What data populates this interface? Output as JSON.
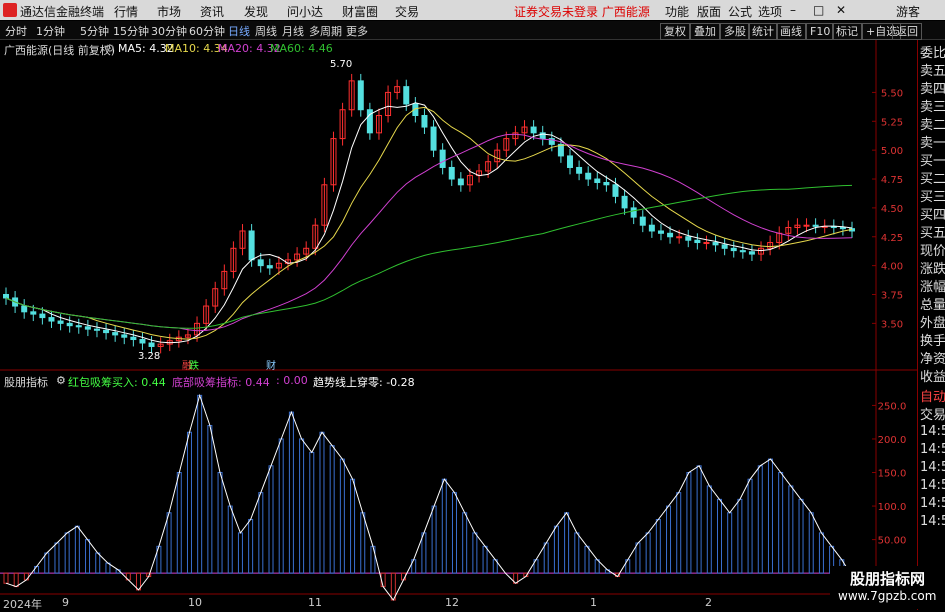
{
  "app": {
    "title": "通达信金融终端"
  },
  "menu": [
    "行情",
    "市场",
    "资讯",
    "发现",
    "问小达",
    "财富圈",
    "交易"
  ],
  "notice": "证券交易未登录  广西能源",
  "right_menu": [
    "功能",
    "版面",
    "公式",
    "选项"
  ],
  "user": "游客",
  "periods": [
    "分时",
    "1分钟",
    "5分钟",
    "15分钟",
    "30分钟",
    "60分钟",
    "日线",
    "周线",
    "月线",
    "多周期",
    "更多"
  ],
  "active_period": "日线",
  "toolbar": [
    "复权",
    "叠加",
    "多股",
    "统计",
    "画线",
    "F10",
    "标记",
    "+自选",
    "返回"
  ],
  "stock_header": {
    "name": "广西能源(日线 前复权)",
    "ma5": "MA5: 4.32",
    "ma10": "MA10: 4.34",
    "ma20": "MA20: 4.32",
    "ma60": "MA60: 4.46"
  },
  "annotations": {
    "high": "5.70",
    "low": "3.28",
    "badge1": "融",
    "badge1b": "跌",
    "badge2": "财"
  },
  "indicator_header": {
    "name": "股朋指标",
    "red_pack": "红包吸筹买入: 0.44",
    "bottom": "底部吸筹指标: 0.44",
    "zero": ": 0.00",
    "trend": "趋势线上穿零: -0.28"
  },
  "sidebar": [
    "委比",
    "卖五",
    "卖四",
    "卖三",
    "卖二",
    "卖一",
    "买一",
    "买二",
    "买三",
    "买四",
    "买五",
    "现价",
    "涨跌",
    "涨幅",
    "总量",
    "外盘",
    "换手",
    "净资",
    "收益",
    "自动",
    "交易",
    "14:56",
    "14:56",
    "14:56",
    "14:56",
    "14:56",
    "14:56"
  ],
  "dates": [
    {
      "label": "2024年"
    },
    {
      "label": "9"
    },
    {
      "label": "10"
    },
    {
      "label": "11"
    },
    {
      "label": "12"
    },
    {
      "label": "1"
    },
    {
      "label": "2"
    }
  ],
  "watermark": {
    "title": "股朋指标网",
    "url": "www.7gpzb.com"
  },
  "chart_data": [
    {
      "type": "candlestick",
      "title": "广西能源(日线 前复权)",
      "ylim": [
        3.2,
        5.85
      ],
      "yticks": [
        "5.50",
        "5.25",
        "5.00",
        "4.75",
        "4.50",
        "4.25",
        "4.00",
        "3.75",
        "3.50"
      ],
      "series": [
        {
          "name": "MA5",
          "color": "#ffffff"
        },
        {
          "name": "MA10",
          "color": "#e6d84c"
        },
        {
          "name": "MA20",
          "color": "#d040d0"
        },
        {
          "name": "MA60",
          "color": "#30c030"
        }
      ],
      "close": [
        3.72,
        3.65,
        3.6,
        3.58,
        3.55,
        3.52,
        3.5,
        3.48,
        3.47,
        3.45,
        3.44,
        3.42,
        3.4,
        3.38,
        3.36,
        3.33,
        3.3,
        3.32,
        3.35,
        3.38,
        3.4,
        3.5,
        3.65,
        3.8,
        3.95,
        4.15,
        4.3,
        4.05,
        4.0,
        3.98,
        4.02,
        4.05,
        4.1,
        4.15,
        4.35,
        4.7,
        5.1,
        5.35,
        5.6,
        5.35,
        5.15,
        5.3,
        5.5,
        5.55,
        5.4,
        5.3,
        5.2,
        5.0,
        4.85,
        4.75,
        4.7,
        4.78,
        4.82,
        4.9,
        5.0,
        5.1,
        5.15,
        5.2,
        5.15,
        5.1,
        5.05,
        4.95,
        4.85,
        4.8,
        4.75,
        4.72,
        4.7,
        4.6,
        4.5,
        4.42,
        4.35,
        4.3,
        4.28,
        4.25,
        4.25,
        4.22,
        4.2,
        4.2,
        4.18,
        4.15,
        4.13,
        4.12,
        4.1,
        4.15,
        4.2,
        4.28,
        4.33,
        4.35,
        4.35,
        4.34,
        4.34,
        4.33,
        4.32,
        4.3
      ]
    },
    {
      "type": "bar",
      "title": "股朋指标",
      "ylim": [
        -40,
        270
      ],
      "yticks": [
        "250.0",
        "200.0",
        "150.0",
        "100.0",
        "50.00",
        "0.00"
      ],
      "values": [
        -15,
        -20,
        -10,
        10,
        30,
        45,
        60,
        70,
        50,
        30,
        15,
        5,
        -10,
        -25,
        -5,
        40,
        90,
        150,
        210,
        265,
        220,
        150,
        100,
        60,
        80,
        120,
        160,
        200,
        240,
        200,
        180,
        210,
        190,
        170,
        140,
        90,
        40,
        -20,
        -40,
        -10,
        20,
        60,
        100,
        140,
        120,
        90,
        60,
        40,
        20,
        0,
        -15,
        -5,
        20,
        45,
        70,
        90,
        60,
        40,
        20,
        5,
        -5,
        20,
        45,
        60,
        80,
        100,
        120,
        150,
        160,
        130,
        110,
        90,
        110,
        140,
        160,
        170,
        150,
        130,
        110,
        90,
        60,
        40,
        20,
        -5
      ]
    }
  ]
}
